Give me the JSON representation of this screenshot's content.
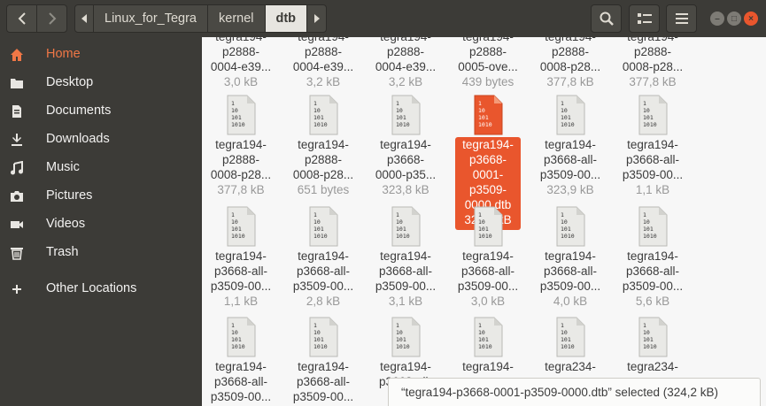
{
  "header": {
    "path": [
      "Linux_for_Tegra",
      "kernel",
      "dtb"
    ],
    "active_path_index": 2
  },
  "window_controls": {
    "minimize": "–",
    "maximize": "□",
    "close": "×"
  },
  "sidebar": {
    "items": [
      {
        "label": "Home",
        "icon": "home-icon",
        "active": true
      },
      {
        "label": "Desktop",
        "icon": "folder-icon"
      },
      {
        "label": "Documents",
        "icon": "document-icon"
      },
      {
        "label": "Downloads",
        "icon": "download-icon"
      },
      {
        "label": "Music",
        "icon": "music-icon"
      },
      {
        "label": "Pictures",
        "icon": "camera-icon"
      },
      {
        "label": "Videos",
        "icon": "video-icon"
      },
      {
        "label": "Trash",
        "icon": "trash-icon"
      },
      {
        "label": "Other Locations",
        "icon": "plus-icon"
      }
    ]
  },
  "files": {
    "row0": [
      {
        "name": [
          "tegra194-",
          "p2888-",
          "0004-e39..."
        ],
        "size": "3,0 kB"
      },
      {
        "name": [
          "tegra194-",
          "p2888-",
          "0004-e39..."
        ],
        "size": "3,2 kB"
      },
      {
        "name": [
          "tegra194-",
          "p2888-",
          "0004-e39..."
        ],
        "size": "3,2 kB"
      },
      {
        "name": [
          "tegra194-",
          "p2888-",
          "0005-ove..."
        ],
        "size": "439 bytes"
      },
      {
        "name": [
          "tegra194-",
          "p2888-",
          "0008-p28..."
        ],
        "size": "377,8 kB"
      },
      {
        "name": [
          "tegra194-",
          "p2888-",
          "0008-p28..."
        ],
        "size": "377,8 kB"
      }
    ],
    "row1": [
      {
        "name": [
          "tegra194-",
          "p2888-",
          "0008-p28..."
        ],
        "size": "377,8 kB"
      },
      {
        "name": [
          "tegra194-",
          "p2888-",
          "0008-p28..."
        ],
        "size": "651 bytes"
      },
      {
        "name": [
          "tegra194-",
          "p3668-",
          "0000-p35..."
        ],
        "size": "323,8 kB"
      },
      {
        "name": [
          "tegra194-",
          "p3668-",
          "0001-",
          "p3509-",
          "0000.dtb"
        ],
        "size": "324,2 kB",
        "selected": true
      },
      {
        "name": [
          "tegra194-",
          "p3668-all-",
          "p3509-00..."
        ],
        "size": "323,9 kB"
      },
      {
        "name": [
          "tegra194-",
          "p3668-all-",
          "p3509-00..."
        ],
        "size": "1,1 kB"
      }
    ],
    "row2": [
      {
        "name": [
          "tegra194-",
          "p3668-all-",
          "p3509-00..."
        ],
        "size": "1,1 kB"
      },
      {
        "name": [
          "tegra194-",
          "p3668-all-",
          "p3509-00..."
        ],
        "size": "2,8 kB"
      },
      {
        "name": [
          "tegra194-",
          "p3668-all-",
          "p3509-00..."
        ],
        "size": "3,1 kB"
      },
      {
        "name": [
          "tegra194-",
          "p3668-all-",
          "p3509-00..."
        ],
        "size": "3,0 kB"
      },
      {
        "name": [
          "tegra194-",
          "p3668-all-",
          "p3509-00..."
        ],
        "size": "4,0 kB"
      },
      {
        "name": [
          "tegra194-",
          "p3668-all-",
          "p3509-00..."
        ],
        "size": "5,6 kB"
      }
    ],
    "row3": [
      {
        "name": [
          "tegra194-",
          "p3668-all-",
          "p3509-00..."
        ]
      },
      {
        "name": [
          "tegra194-",
          "p3668-all-",
          "p3509-00..."
        ]
      },
      {
        "name": [
          "tegra194-",
          "p3668-all-"
        ]
      },
      {
        "name": [
          "tegra194-"
        ]
      },
      {
        "name": [
          "tegra234-"
        ]
      },
      {
        "name": [
          "tegra234-"
        ]
      }
    ]
  },
  "status": {
    "text": "“tegra194-p3668-0001-p3509-0000.dtb” selected  (324,2 kB)"
  },
  "icon_glyph": [
    "1",
    "10",
    "101",
    "1010"
  ],
  "colors": {
    "accent": "#e9562d",
    "sidebar": "#3c3b37",
    "active_sidebar": "#f07746"
  }
}
